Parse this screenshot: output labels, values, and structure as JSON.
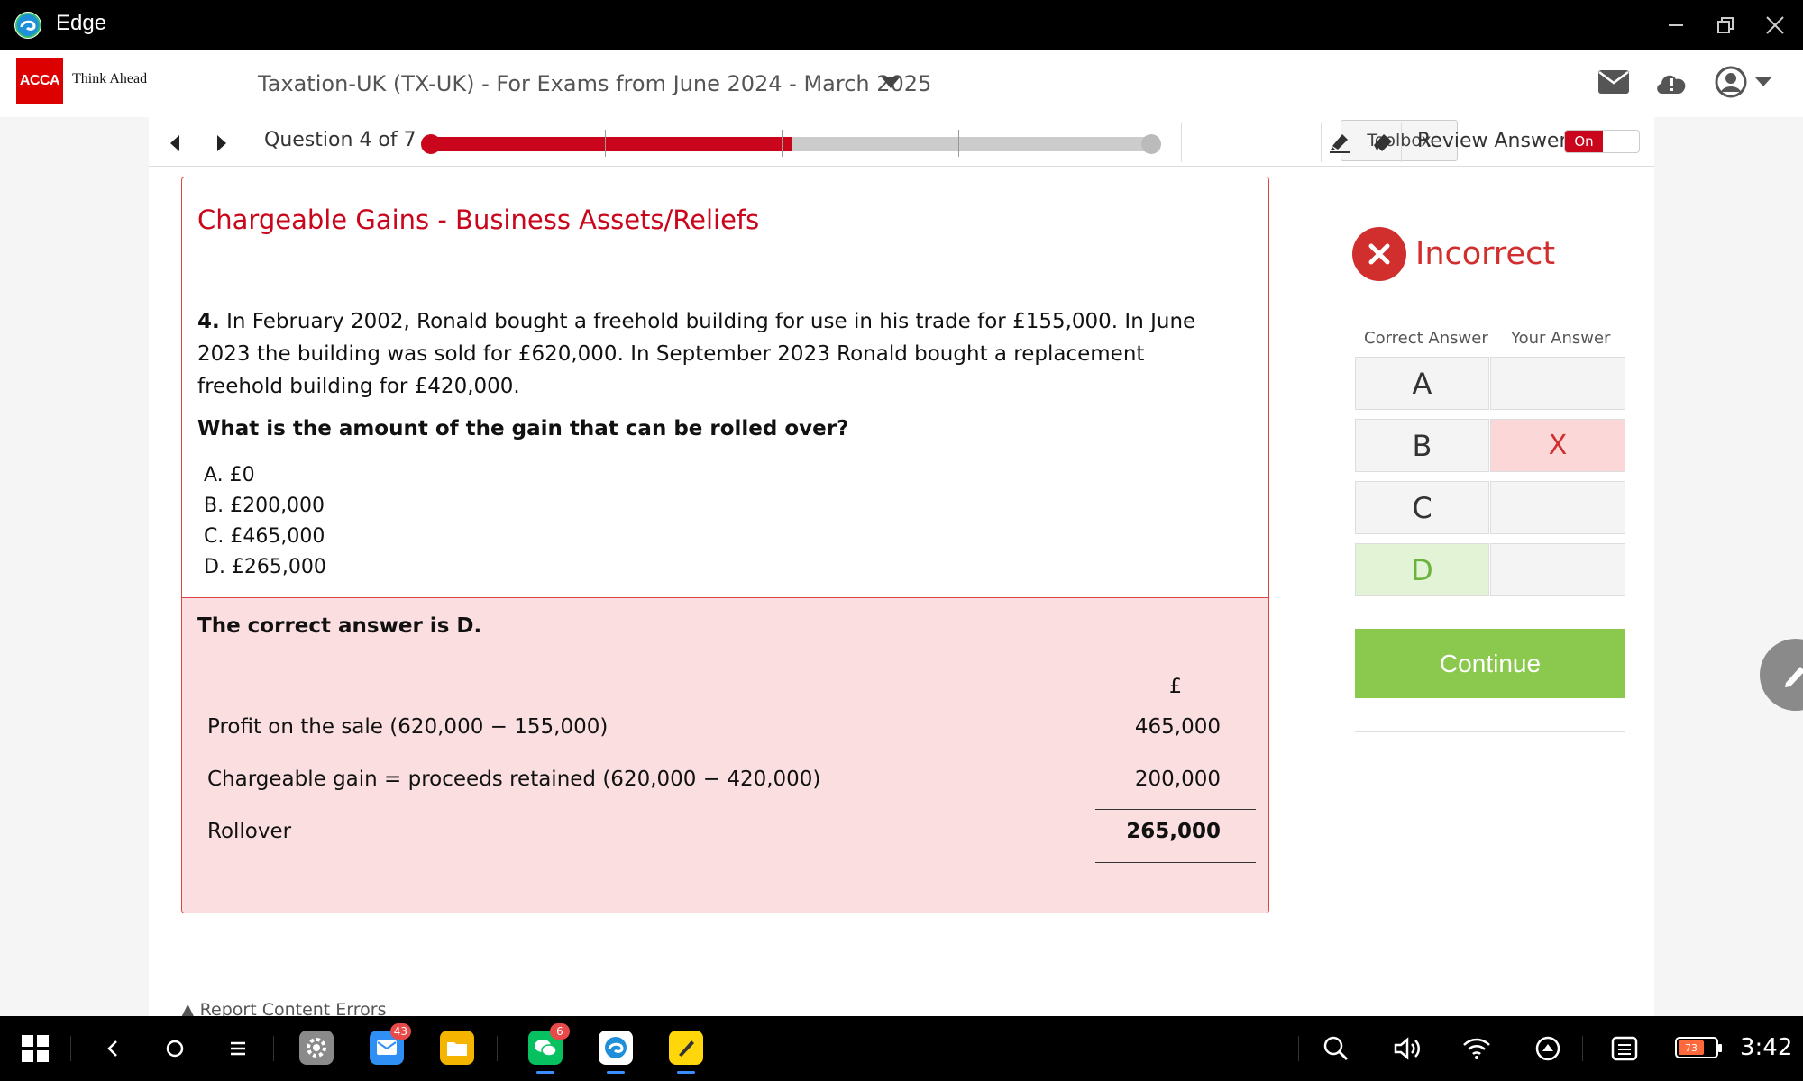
{
  "window": {
    "app_title": "Edge"
  },
  "header": {
    "logo_text": "ACCA",
    "tagline": "Think Ahead",
    "course_title": "Taxation-UK (TX-UK) - For Exams from June 2024 - March 2025"
  },
  "navbar": {
    "question_counter": "Question 4 of 7",
    "progress": {
      "current": 4,
      "total": 7
    },
    "toolbox_label": "Toolbox",
    "review_label": "Review Answer",
    "review_toggle": "On"
  },
  "question": {
    "topic": "Chargeable Gains - Business Assets/Reliefs",
    "number": "4.",
    "text": "In February 2002, Ronald bought a freehold building for use in his trade for £155,000. In June 2023 the building was sold for £620,000. In September 2023 Ronald bought a replacement freehold building for £420,000.",
    "prompt": "What is the amount of the gain that can be rolled over?",
    "options": [
      "A. £0",
      "B. £200,000",
      "C. £465,000",
      "D. £265,000"
    ]
  },
  "explanation": {
    "title": "The correct answer is D.",
    "currency": "£",
    "rows": [
      {
        "label": "Profit on the sale (620,000 − 155,000)",
        "amount": "465,000"
      },
      {
        "label": "Chargeable gain = proceeds retained (620,000 − 420,000)",
        "amount": "200,000"
      },
      {
        "label": "Rollover",
        "amount": "265,000"
      }
    ]
  },
  "report_link": "Report Content Errors",
  "result": {
    "status": "Incorrect",
    "col_correct": "Correct Answer",
    "col_yours": "Your Answer",
    "rows": [
      {
        "letter": "A",
        "yours": ""
      },
      {
        "letter": "B",
        "yours": "X"
      },
      {
        "letter": "C",
        "yours": ""
      },
      {
        "letter": "D",
        "yours": ""
      }
    ],
    "correct_letter": "D",
    "continue_label": "Continue"
  },
  "taskbar": {
    "mail_badge": "43",
    "wechat_badge": "6",
    "battery": "73",
    "clock": "3:42"
  },
  "colors": {
    "accent_red": "#c9061b",
    "incorrect_red": "#d12e2e",
    "continue_green": "#8ac94e",
    "explain_bg": "#fbdfe0"
  }
}
